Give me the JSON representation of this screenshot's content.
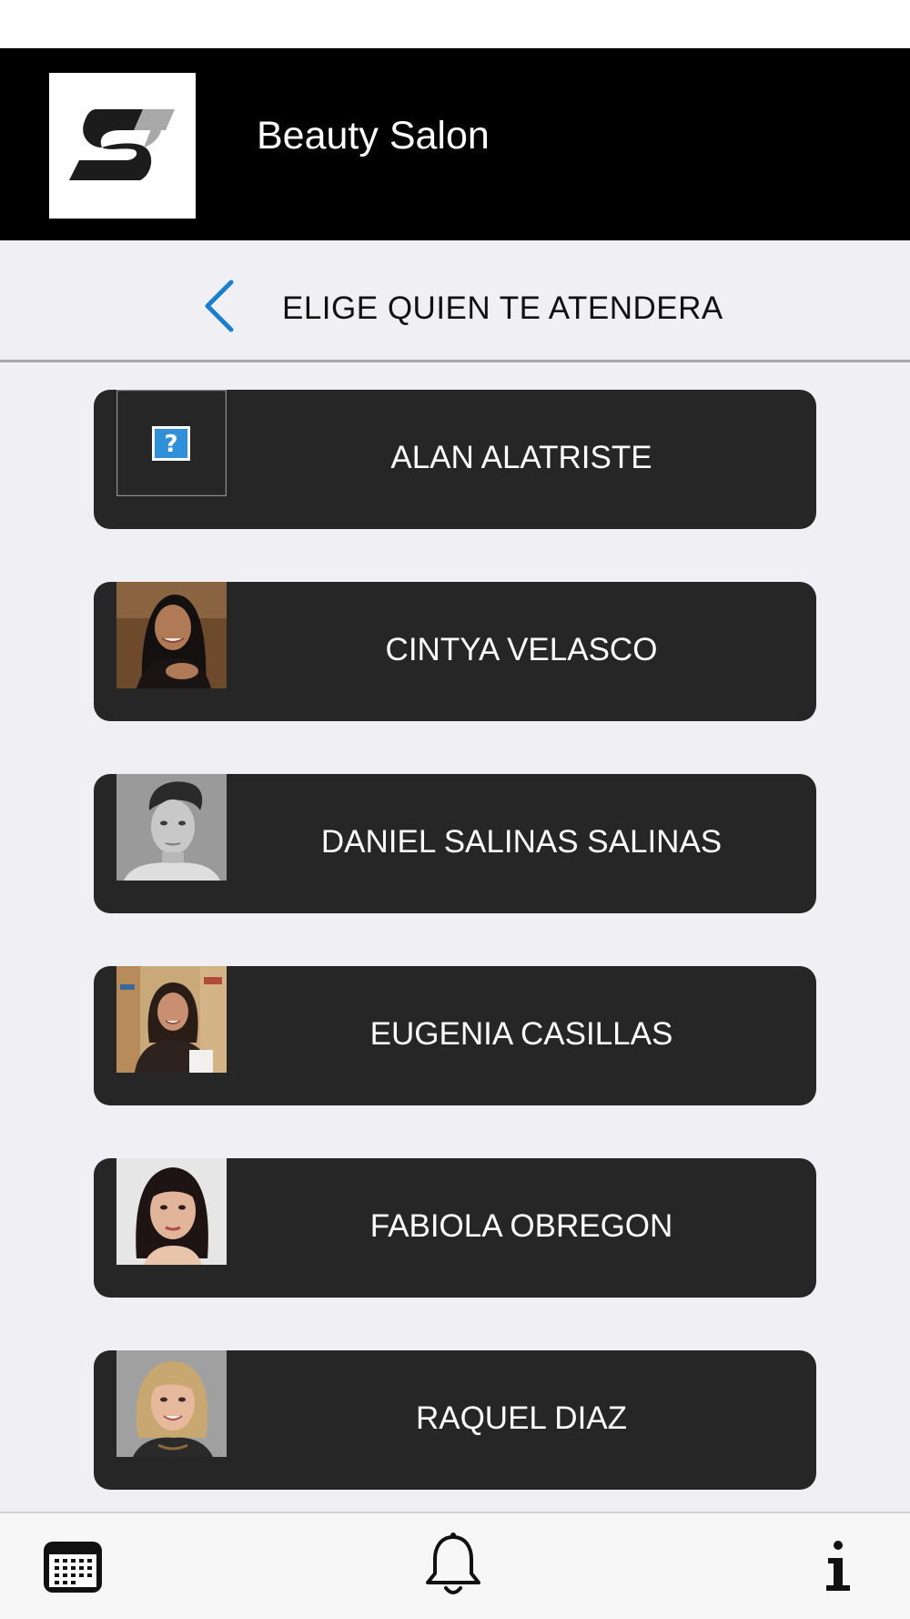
{
  "app": {
    "title": "Beauty Salon",
    "logo_icon": "salon-logo-icon"
  },
  "nav": {
    "back_icon": "chevron-left-icon",
    "title": "ELIGE QUIEN TE ATENDERA"
  },
  "staff": [
    {
      "name": "ALAN ALATRISTE",
      "photo": "missing-image-placeholder"
    },
    {
      "name": "CINTYA VELASCO",
      "photo": "woman-portrait"
    },
    {
      "name": "DANIEL SALINAS SALINAS",
      "photo": "man-portrait"
    },
    {
      "name": "EUGENIA CASILLAS",
      "photo": "woman-portrait"
    },
    {
      "name": "FABIOLA OBREGON",
      "photo": "woman-portrait"
    },
    {
      "name": "RAQUEL DIAZ",
      "photo": "woman-portrait"
    }
  ],
  "tabs": [
    {
      "icon": "calendar-icon"
    },
    {
      "icon": "bell-icon"
    },
    {
      "icon": "info-icon"
    }
  ],
  "colors": {
    "header_bg": "#000000",
    "page_bg": "#efeff4",
    "card_bg": "#262626",
    "accent": "#1a7fd0"
  }
}
